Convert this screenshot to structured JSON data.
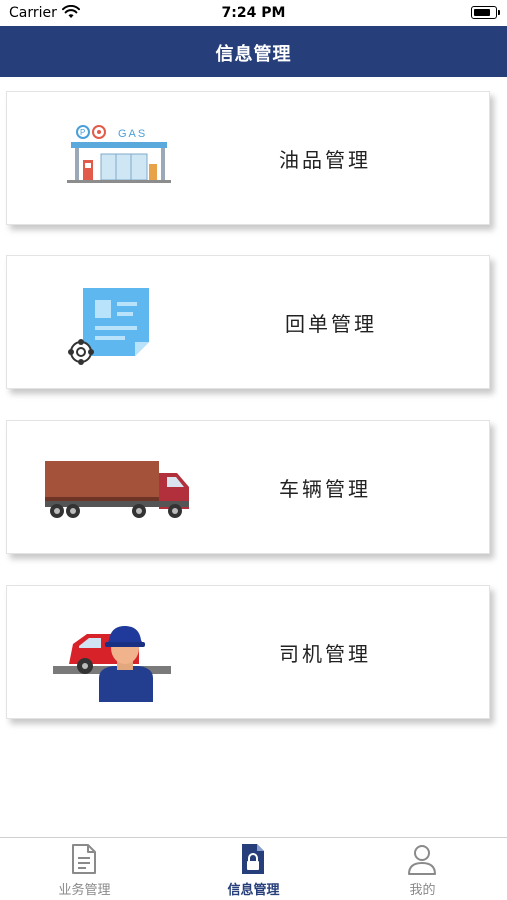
{
  "status_bar": {
    "carrier": "Carrier",
    "time": "7:24 PM",
    "battery_level": 0.85
  },
  "nav": {
    "title": "信息管理"
  },
  "menu": {
    "items": [
      {
        "label": "油品管理",
        "icon": "gas-station-icon",
        "icon_text": "GAS"
      },
      {
        "label": "回单管理",
        "icon": "receipt-document-icon"
      },
      {
        "label": "车辆管理",
        "icon": "truck-icon"
      },
      {
        "label": "司机管理",
        "icon": "driver-icon"
      }
    ]
  },
  "tabs": [
    {
      "label": "业务管理",
      "icon": "document-icon",
      "active": false
    },
    {
      "label": "信息管理",
      "icon": "secure-document-icon",
      "active": true
    },
    {
      "label": "我的",
      "icon": "user-icon",
      "active": false
    }
  ],
  "colors": {
    "brand": "#263f7a",
    "tab_inactive": "#8a8a8a"
  }
}
